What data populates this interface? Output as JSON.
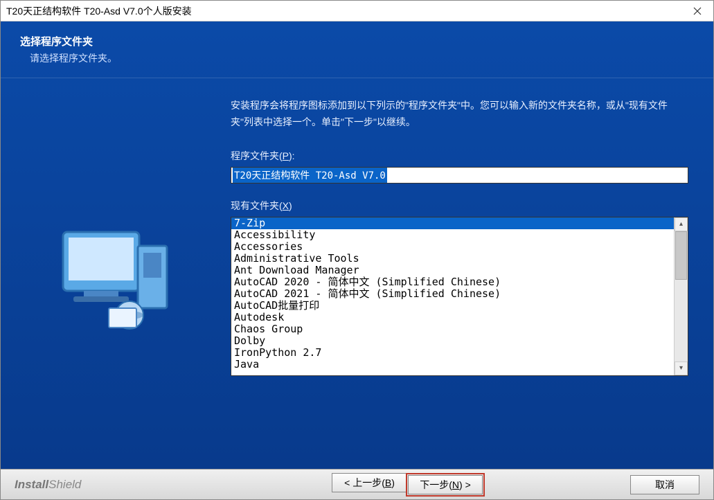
{
  "window": {
    "title": "T20天正结构软件 T20-Asd V7.0个人版安装"
  },
  "header": {
    "title": "选择程序文件夹",
    "subtitle": "请选择程序文件夹。"
  },
  "description": "安装程序会将程序图标添加到以下列示的\"程序文件夹\"中。您可以输入新的文件夹名称，或从\"现有文件夹\"列表中选择一个。单击\"下一步\"以继续。",
  "program_folder": {
    "label_pre": "程序文件夹(",
    "label_hotkey": "P",
    "label_post": "):",
    "value": "T20天正结构软件 T20-Asd V7.0"
  },
  "existing_folders": {
    "label_pre": "现有文件夹(",
    "label_hotkey": "X",
    "label_post": ")",
    "selected": "7-Zip",
    "items": [
      "7-Zip",
      "Accessibility",
      "Accessories",
      "Administrative Tools",
      "Ant Download Manager",
      "AutoCAD 2020 - 简体中文 (Simplified Chinese)",
      "AutoCAD 2021 - 简体中文 (Simplified Chinese)",
      "AutoCAD批量打印",
      "Autodesk",
      "Chaos Group",
      "Dolby",
      "IronPython 2.7",
      "Java"
    ]
  },
  "footer": {
    "brand_bold": "Install",
    "brand_rest": "Shield",
    "back_pre": "< 上一步(",
    "back_hotkey": "B",
    "back_post": ")",
    "next_pre": "下一步(",
    "next_hotkey": "N",
    "next_post": ") >",
    "cancel": "取消"
  }
}
